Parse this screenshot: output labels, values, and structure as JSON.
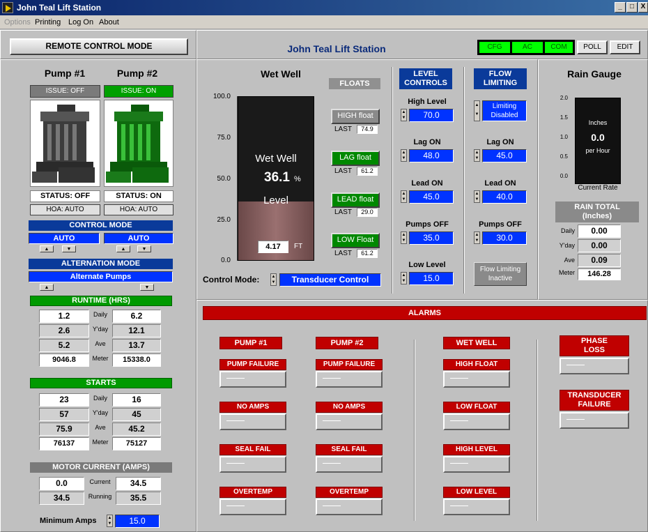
{
  "window": {
    "title": "John Teal Lift Station",
    "minimize": "_",
    "maximize": "□",
    "close": "X"
  },
  "menu": {
    "options": "Options",
    "printing": "Printing",
    "logon": "Log On",
    "about": "About"
  },
  "mode_button": "REMOTE CONTROL MODE",
  "station_title": "John Teal Lift Station",
  "status_buttons": {
    "cfg": "CFG",
    "ac": "AC",
    "com": "COM",
    "poll": "POLL",
    "edit": "EDIT"
  },
  "colors": {
    "status_green": "#00ff00",
    "alarm_red": "#c00000",
    "field_blue": "#0033ff",
    "active_green": "#008800"
  },
  "pumps": [
    {
      "name": "Pump #1",
      "issue": "ISSUE: OFF",
      "status": "STATUS: OFF",
      "hoa": "HOA: AUTO",
      "mode": "AUTO"
    },
    {
      "name": "Pump #2",
      "issue": "ISSUE: ON",
      "status": "STATUS: ON",
      "hoa": "HOA: AUTO",
      "mode": "AUTO"
    }
  ],
  "control_mode_label": "CONTROL MODE",
  "alternation_label": "ALTERNATION MODE",
  "alternation_value": "Alternate Pumps",
  "runtime": {
    "title": "RUNTIME (HRS)",
    "rows": [
      {
        "label": "Daily",
        "p1": "1.2",
        "p2": "6.2"
      },
      {
        "label": "Y'day",
        "p1": "2.6",
        "p2": "12.1"
      },
      {
        "label": "Ave",
        "p1": "5.2",
        "p2": "13.7"
      },
      {
        "label": "Meter",
        "p1": "9046.8",
        "p2": "15338.0"
      }
    ]
  },
  "starts": {
    "title": "STARTS",
    "rows": [
      {
        "label": "Daily",
        "p1": "23",
        "p2": "16"
      },
      {
        "label": "Y'day",
        "p1": "57",
        "p2": "45"
      },
      {
        "label": "Ave",
        "p1": "75.9",
        "p2": "45.2"
      },
      {
        "label": "Meter",
        "p1": "76137",
        "p2": "75127"
      }
    ]
  },
  "motor_current": {
    "title": "MOTOR CURRENT (AMPS)",
    "rows": [
      {
        "label": "Current",
        "p1": "0.0",
        "p2": "34.5"
      },
      {
        "label": "Running",
        "p1": "34.5",
        "p2": "35.5"
      }
    ]
  },
  "min_amps": {
    "label": "Minimum Amps",
    "value": "15.0"
  },
  "wet_well": {
    "title": "Wet Well",
    "label_top": "Wet Well",
    "percent": "36.1",
    "percent_unit": "%",
    "label_bottom": "Level",
    "level_ft": "4.17",
    "unit": "FT",
    "fill_fraction": 0.361,
    "ticks": [
      "100.0",
      "75.0",
      "50.0",
      "25.0",
      "0.0"
    ]
  },
  "control_mode": {
    "label": "Control Mode:",
    "value": "Transducer Control"
  },
  "floats": {
    "title": "FLOATS",
    "items": [
      {
        "label": "HIGH float",
        "last_label": "LAST",
        "last": "74.9",
        "active": false
      },
      {
        "label": "LAG float",
        "last_label": "LAST",
        "last": "61.2",
        "active": true
      },
      {
        "label": "LEAD float",
        "last_label": "LAST",
        "last": "29.0",
        "active": true
      },
      {
        "label": "LOW Float",
        "last_label": "LAST",
        "last": "61.2",
        "active": true
      }
    ]
  },
  "level_controls": {
    "title_1": "LEVEL",
    "title_2": "CONTROLS",
    "items": [
      {
        "label": "High Level",
        "value": "70.0"
      },
      {
        "label": "Lag ON",
        "value": "48.0"
      },
      {
        "label": "Lead ON",
        "value": "45.0"
      },
      {
        "label": "Pumps OFF",
        "value": "35.0"
      },
      {
        "label": "Low Level",
        "value": "15.0"
      }
    ]
  },
  "flow_limiting": {
    "title_1": "FLOW",
    "title_2": "LIMITING",
    "mode_line1": "Limiting",
    "mode_line2": "Disabled",
    "items": [
      {
        "label": "Lag ON",
        "value": "45.0"
      },
      {
        "label": "Lead ON",
        "value": "40.0"
      },
      {
        "label": "Pumps OFF",
        "value": "30.0"
      }
    ],
    "status_line1": "Flow Limiting",
    "status_line2": "Inactive"
  },
  "rain": {
    "title": "Rain Gauge",
    "ticks": [
      "2.0",
      "1.5",
      "1.0",
      "0.5",
      "0.0"
    ],
    "unit": "Inches",
    "value": "0.0",
    "per": "per Hour",
    "caption": "Current Rate",
    "total_title_1": "RAIN TOTAL",
    "total_title_2": "(Inches)",
    "rows": [
      {
        "label": "Daily",
        "value": "0.00"
      },
      {
        "label": "Y'day",
        "value": "0.00"
      },
      {
        "label": "Ave",
        "value": "0.09"
      },
      {
        "label": "Meter",
        "value": "146.28"
      }
    ]
  },
  "alarms": {
    "title": "ALARMS",
    "col_pump1": {
      "title": "PUMP #1",
      "items": [
        "PUMP FAILURE",
        "NO AMPS",
        "SEAL FAIL",
        "OVERTEMP"
      ]
    },
    "col_pump2": {
      "title": "PUMP #2",
      "items": [
        "PUMP FAILURE",
        "NO AMPS",
        "SEAL FAIL",
        "OVERTEMP"
      ]
    },
    "col_wetwell": {
      "title": "WET WELL",
      "items": [
        "HIGH FLOAT",
        "LOW FLOAT",
        "HIGH LEVEL",
        "LOW LEVEL"
      ]
    },
    "col_other": [
      {
        "line1": "PHASE",
        "line2": "LOSS"
      },
      {
        "line1": "TRANSDUCER",
        "line2": "FAILURE"
      }
    ]
  }
}
